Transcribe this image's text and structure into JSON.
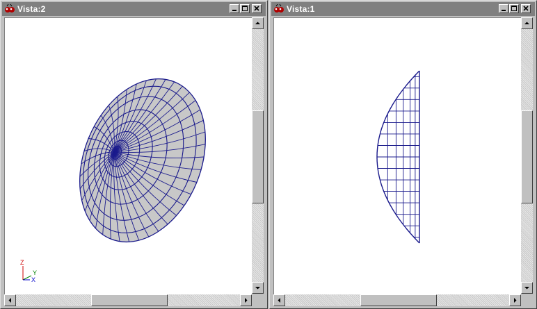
{
  "windows": [
    {
      "title": "Vista:2",
      "icon": "app-logo-icon",
      "buttons": [
        "minimize-icon",
        "maximize-icon",
        "close-icon"
      ],
      "viewport": "perspective-view",
      "axis_labels": {
        "z": "Z",
        "y": "Y",
        "x": "X"
      },
      "colors": {
        "wire": "#1a1a8c",
        "surface": "#c8c8c8",
        "axis_z": "#cc0000",
        "axis_y": "#008000",
        "axis_x": "#0000cc"
      }
    },
    {
      "title": "Vista:1",
      "icon": "app-logo-icon",
      "buttons": [
        "minimize-icon",
        "maximize-icon",
        "close-icon"
      ],
      "viewport": "side-view",
      "colors": {
        "wire": "#1a1a8c"
      }
    }
  ],
  "colors": {
    "titlebar_inactive": "#808080",
    "titlebar_text": "#ffffff",
    "face": "#c0c0c0",
    "canvas": "#ffffff"
  }
}
